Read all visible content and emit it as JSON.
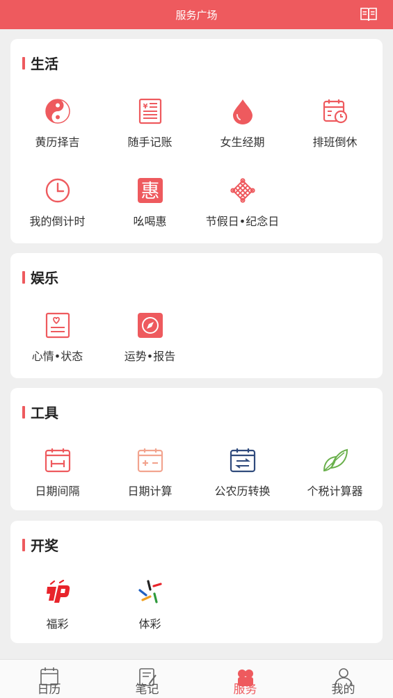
{
  "header": {
    "title": "服务广场",
    "book_icon": "book-icon"
  },
  "colors": {
    "accent": "#ee5a5e",
    "blue": "#2f4a7c",
    "green": "#6ab04c"
  },
  "sections": {
    "life": {
      "title": "生活",
      "items": [
        {
          "label": "黄历择吉",
          "icon": "yin-yang-icon"
        },
        {
          "label": "随手记账",
          "icon": "ledger-icon"
        },
        {
          "label": "女生经期",
          "icon": "blood-drop-icon"
        },
        {
          "label": "排班倒休",
          "icon": "shift-calendar-icon"
        },
        {
          "label": "我的倒计时",
          "icon": "clock-icon"
        },
        {
          "label": "吆喝惠",
          "icon": "discount-icon",
          "glyph": "惠"
        },
        {
          "label": "节假日•纪念日",
          "icon": "chinese-knot-icon"
        }
      ]
    },
    "entertainment": {
      "title": "娱乐",
      "items": [
        {
          "label": "心情•状态",
          "icon": "mood-icon"
        },
        {
          "label": "运势•报告",
          "icon": "compass-icon"
        }
      ]
    },
    "tools": {
      "title": "工具",
      "items": [
        {
          "label": "日期间隔",
          "icon": "date-interval-icon"
        },
        {
          "label": "日期计算",
          "icon": "date-calc-icon"
        },
        {
          "label": "公农历转换",
          "icon": "calendar-convert-icon"
        },
        {
          "label": "个税计算器",
          "icon": "leaf-icon"
        }
      ]
    },
    "lottery": {
      "title": "开奖",
      "items": [
        {
          "label": "福彩",
          "icon": "welfare-lottery-icon"
        },
        {
          "label": "体彩",
          "icon": "sports-lottery-icon"
        }
      ]
    }
  },
  "tabbar": {
    "tabs": [
      {
        "label": "日历",
        "icon": "calendar-tab-icon",
        "active": false
      },
      {
        "label": "笔记",
        "icon": "notes-tab-icon",
        "active": false
      },
      {
        "label": "服务",
        "icon": "service-tab-icon",
        "active": true
      },
      {
        "label": "我的",
        "icon": "profile-tab-icon",
        "active": false
      }
    ]
  }
}
